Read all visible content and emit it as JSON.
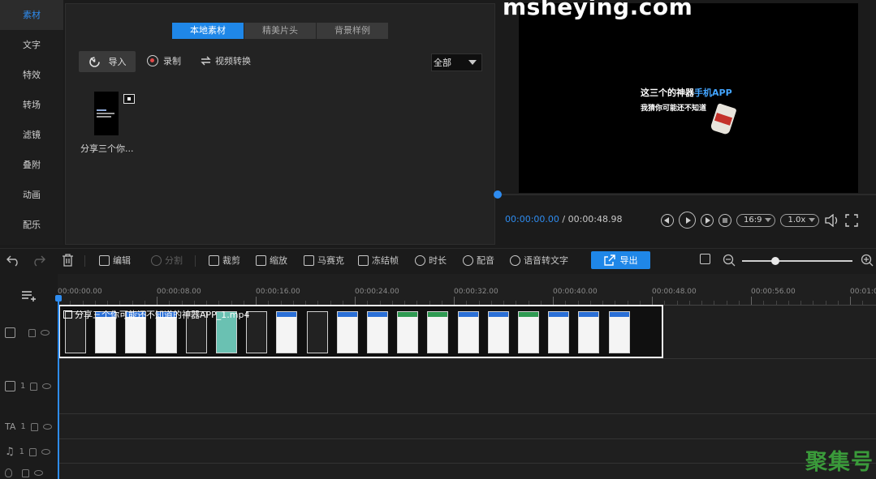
{
  "sidebar": {
    "items": [
      {
        "label": "素材",
        "active": true
      },
      {
        "label": "文字",
        "active": false
      },
      {
        "label": "特效",
        "active": false
      },
      {
        "label": "转场",
        "active": false
      },
      {
        "label": "滤镜",
        "active": false
      },
      {
        "label": "叠附",
        "active": false
      },
      {
        "label": "动画",
        "active": false
      },
      {
        "label": "配乐",
        "active": false
      }
    ]
  },
  "media_panel": {
    "tabs": [
      {
        "label": "本地素材",
        "active": true
      },
      {
        "label": "精美片头",
        "active": false
      },
      {
        "label": "背景样例",
        "active": false
      }
    ],
    "import_label": "导入",
    "record_label": "录制",
    "convert_label": "视频转换",
    "filter_selected": "全部",
    "item_name": "分享三个你..."
  },
  "preview": {
    "watermark": "msheying.com",
    "caption_line1_prefix": "这三个的神器",
    "caption_line1_highlight": "手机APP",
    "caption_line2": "我猜你可能还不知道",
    "time_current": "00:00:00.00",
    "time_separator": " / ",
    "time_total": "00:00:48.98",
    "aspect_ratio": "16:9",
    "speed": "1.0x",
    "progress": 0
  },
  "toolbar": {
    "edit_label": "编辑",
    "split_label": "分割",
    "crop_label": "裁剪",
    "zoom_label": "缩放",
    "mosaic_label": "马赛克",
    "freeze_label": "冻结帧",
    "duration_label": "时长",
    "dub_label": "配音",
    "speech_to_text_label": "语音转文字",
    "export_label": "导出"
  },
  "timeline": {
    "ruler_labels": [
      "00:00:00.00",
      "00:00:08.00",
      "00:00:16.00",
      "00:00:24.00",
      "00:00:32.00",
      "00:00:40.00",
      "00:00:48.00",
      "00:00:56.00",
      "00:01:0"
    ],
    "clip_title": "分享三个你可能还不知道的神器APP_1.mp4",
    "track_count_pip": "1",
    "track_count_text": "1",
    "track_count_music": "1"
  },
  "corner_logo": "聚集号",
  "colors": {
    "accent": "#1f87e8",
    "playhead": "#2e8cf0",
    "highlight_text": "#43a5ff"
  }
}
